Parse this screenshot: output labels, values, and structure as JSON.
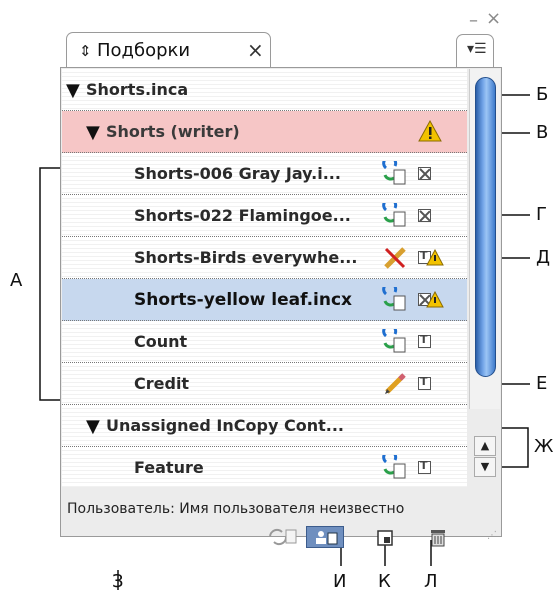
{
  "panel": {
    "title": "Подборки",
    "rows": [
      {
        "label": "Shorts.inca",
        "kind": "document",
        "expanded": true
      },
      {
        "label": "Shorts (writer)",
        "kind": "assignment",
        "expanded": true,
        "status": "warning"
      },
      {
        "label": "Shorts-006 Gray Jay.i...",
        "kind": "story",
        "icons": [
          "incopy-icon",
          "unavailable-content-icon"
        ]
      },
      {
        "label": "Shorts-022 Flamingoe...",
        "kind": "story",
        "icons": [
          "incopy-icon",
          "unavailable-content-icon"
        ]
      },
      {
        "label": "Shorts-Birds everywhe...",
        "kind": "story",
        "icons": [
          "checked-out-by-other-icon",
          "text-frame-warning-icon"
        ]
      },
      {
        "label": "Shorts-yellow leaf.incx",
        "kind": "story",
        "selected": true,
        "icons": [
          "incopy-icon",
          "image-frame-warning-icon"
        ]
      },
      {
        "label": "Count",
        "kind": "story",
        "icons": [
          "incopy-icon",
          "text-frame-icon"
        ]
      },
      {
        "label": "Credit",
        "kind": "story",
        "icons": [
          "edit-pencil-icon",
          "text-frame-icon"
        ]
      },
      {
        "label": "Unassigned InCopy Cont...",
        "kind": "group",
        "expanded": true
      },
      {
        "label": "Feature",
        "kind": "story",
        "icons": [
          "incopy-icon",
          "text-frame-icon"
        ]
      }
    ],
    "user_line": "Пользователь:  Имя пользователя неизвестно",
    "footer_buttons": [
      "sync-button",
      "check-out-button",
      "new-assignment-button",
      "delete-button"
    ]
  },
  "callouts": {
    "a": "А",
    "b": "Б",
    "v": "В",
    "g": "Г",
    "d": "Д",
    "e": "Е",
    "zh": "Ж",
    "z": "З",
    "i": "И",
    "k": "К",
    "l": "Л"
  },
  "colors": {
    "assignment_row": "#f6c6c6",
    "selected_row": "#c7d8ee",
    "scroll_thumb": "#4f88d4",
    "warning": "#f2c200"
  }
}
